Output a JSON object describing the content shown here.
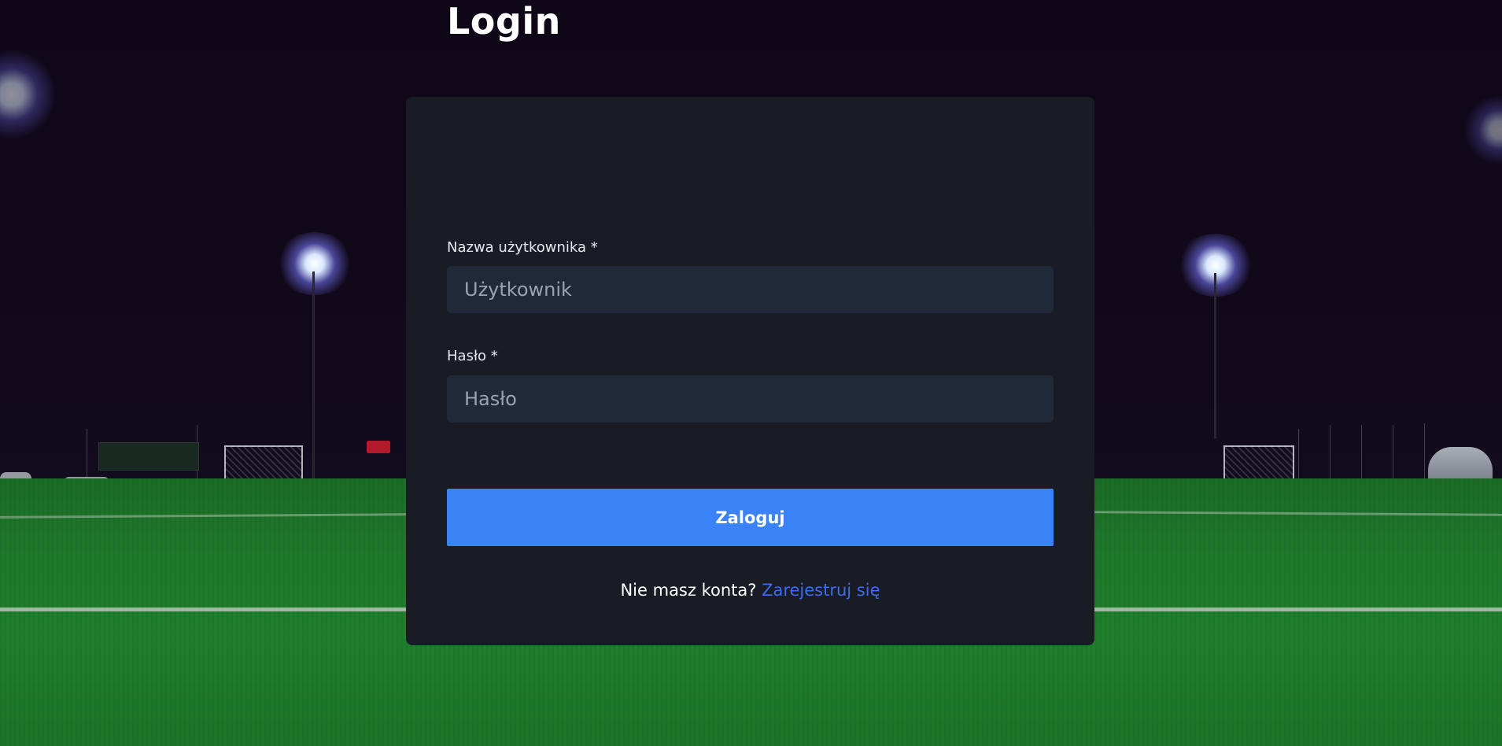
{
  "login": {
    "title": "Login",
    "username": {
      "label": "Nazwa użytkownika *",
      "placeholder": "Użytkownik",
      "value": ""
    },
    "password": {
      "label": "Hasło *",
      "placeholder": "Hasło",
      "value": ""
    },
    "submit_label": "Zaloguj",
    "footer": {
      "prompt": "Nie masz konta?",
      "link_label": "Zarejestruj się"
    }
  },
  "colors": {
    "card_background": "#1a1c25",
    "input_background": "#1f2937",
    "primary_button": "#3b82f6",
    "link": "#3b6cf0",
    "title_text": "#ffffff"
  },
  "background": {
    "icon": "stadium-night-image"
  }
}
